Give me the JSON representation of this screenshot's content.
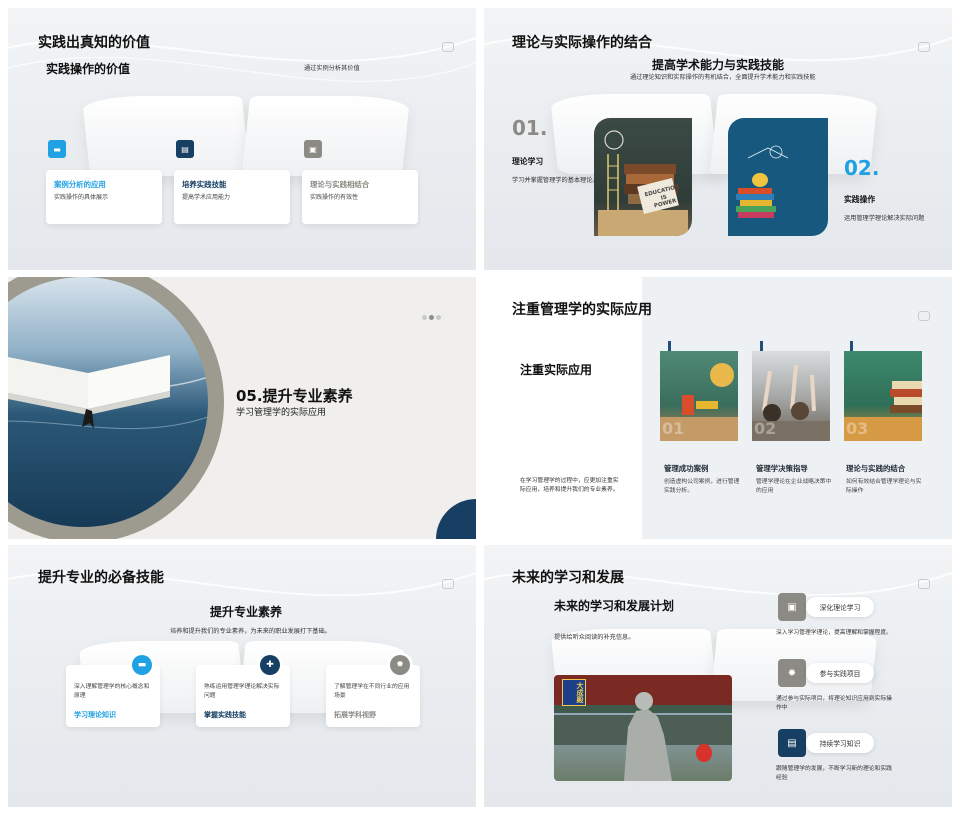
{
  "colors": {
    "accent_blue": "#1fa1e3",
    "navy": "#163f63",
    "gray": "#8c8a84",
    "ring": "#9d9a8f"
  },
  "slide1": {
    "title": "实践出真知的价值",
    "subtitle": "实践操作的价值",
    "note": "通过实例分析其价值",
    "cards": [
      {
        "title": "案例分析的应用",
        "desc": "实践操作的具体展示",
        "icon": "folder-icon"
      },
      {
        "title": "培养实践技能",
        "desc": "提高学术应用能力",
        "icon": "document-icon"
      },
      {
        "title": "理论与实践相结合",
        "desc": "实践操作的有效性",
        "icon": "image-icon"
      }
    ]
  },
  "slide2": {
    "title": "理论与实际操作的结合",
    "subtitle": "提高学术能力与实践技能",
    "note": "通过理论知识和实际操作的有机结合，全面提升学术能力和实践技能",
    "left": {
      "num": "01.",
      "title": "理论学习",
      "desc": "学习并掌握管理学的基本理论。"
    },
    "right": {
      "num": "02.",
      "title": "实践操作",
      "desc": "运用管理学理论解决实际问题"
    },
    "board_text": [
      "EDUCATION",
      "IS",
      "POWER"
    ]
  },
  "slide3": {
    "title": "05.提升专业素养",
    "subtitle": "学习管理学的实际应用"
  },
  "slide4": {
    "title": "注重管理学的实际应用",
    "subtitle": "注重实际应用",
    "desc": "在学习管理学的过程中，应更加注重实际应用，培养和提升我们的专业素养。",
    "photo_numbers": [
      "01",
      "02",
      "03"
    ],
    "cols": [
      {
        "title": "管理成功案例",
        "desc": "创造虚构公司案例，进行管理实践分析。"
      },
      {
        "title": "管理学决策指导",
        "desc": "管理学理论在企业战略决策中的应用"
      },
      {
        "title": "理论与实践的结合",
        "desc": "如何有效结合管理学理论与实际操作"
      }
    ]
  },
  "slide5": {
    "title": "提升专业的必备技能",
    "subtitle": "提升专业素养",
    "note": "培养和提升我们的专业素养，为未来的职业发展打下基础。",
    "cards": [
      {
        "desc": "深入理解管理学的核心概念和原理",
        "title": "学习理论知识",
        "icon": "folder-icon"
      },
      {
        "desc": "熟练运用管理学理论解决实际问题",
        "title": "掌握实践技能",
        "icon": "puzzle-icon"
      },
      {
        "desc": "了解管理学在不同行业的应用场景",
        "title": "拓展学科视野",
        "icon": "gear-icon"
      }
    ]
  },
  "slide6": {
    "title": "未来的学习和发展",
    "subtitle": "未来的学习和发展计划",
    "note": "提供给听众阅读的补充信息。",
    "sign_text": "大成殿",
    "items": [
      {
        "label": "深化理论学习",
        "desc": "深入学习管理学理论，提高理解和掌握程度。",
        "icon": "image-icon"
      },
      {
        "label": "参与实践项目",
        "desc": "通过参与实际项目，将理论知识应用到实际操作中",
        "icon": "gear-icon"
      },
      {
        "label": "持续学习知识",
        "desc": "跟随管理学的发展，不断学习新的理论和实践经验",
        "icon": "document-icon"
      }
    ]
  }
}
